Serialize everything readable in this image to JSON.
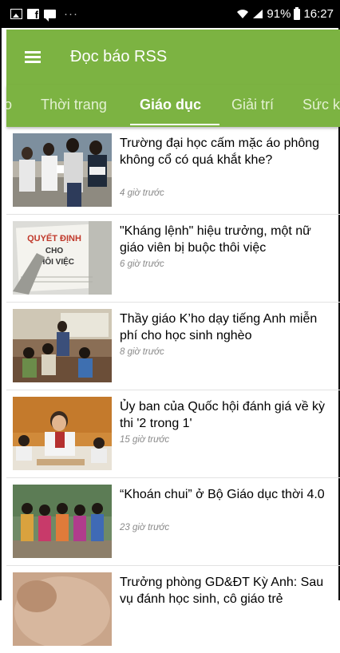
{
  "status_bar": {
    "battery": "91%",
    "time": "16:27",
    "more": "···"
  },
  "app_bar": {
    "title": "Đọc báo RSS"
  },
  "tabs": [
    "o",
    "Thời trang",
    "Giáo dục",
    "Giải trí",
    "Sức k"
  ],
  "active_tab": "Giáo dục",
  "articles": [
    {
      "title": "Trường đại học cấm mặc áo phông không cổ có quá khắt khe?",
      "time": "4 giờ trước"
    },
    {
      "title": "\"Kháng lệnh\" hiệu trưởng, một nữ giáo viên bị buộc thôi việc",
      "time": "6 giờ trước",
      "thumb_text": {
        "line1": "QUYẾT ĐỊNH",
        "line2": "CHO",
        "line3": "THÔI VIỆC"
      }
    },
    {
      "title": "Thầy giáo K’ho dạy tiếng Anh miễn phí cho học sinh nghèo",
      "time": "8 giờ trước"
    },
    {
      "title": "Ủy ban của Quốc hội đánh giá về kỳ thi '2 trong 1'",
      "time": "15 giờ trước"
    },
    {
      "title": "“Khoán chui” ở Bộ Giáo dục thời 4.0",
      "time": "23 giờ trước"
    },
    {
      "title": "Trưởng phòng GD&ĐT Kỳ Anh: Sau vụ đánh học sinh, cô giáo trẻ",
      "time": ""
    }
  ],
  "colors": {
    "primary": "#7cb342",
    "status_bar": "#000000",
    "time_text": "#8a8a8a"
  }
}
